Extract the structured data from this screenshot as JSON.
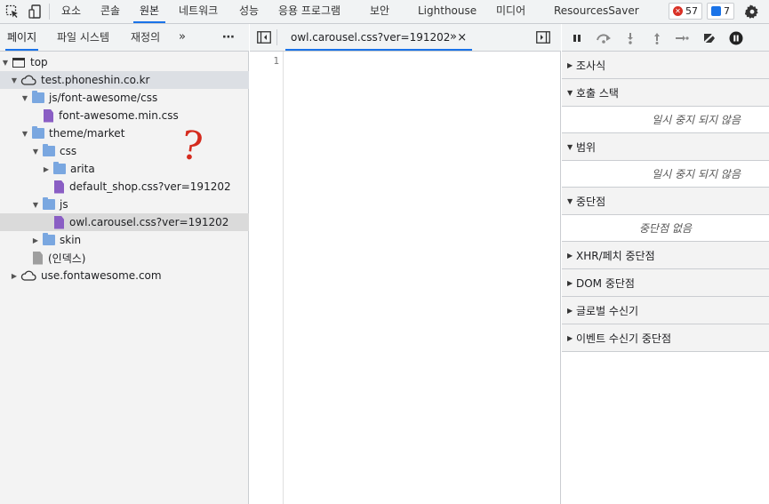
{
  "top_tabs": [
    "요소",
    "콘솔",
    "원본",
    "네트워크",
    "성능",
    "응용 프로그램",
    "보안",
    "Lighthouse",
    "미디어",
    "ResourcesSaver"
  ],
  "badges": {
    "errors": "57",
    "messages": "7"
  },
  "colors": {
    "accent": "#1a73e8",
    "error": "#d93025",
    "info": "#1a73e8",
    "annotation": "#d52b1e"
  },
  "navigator": {
    "tabs": [
      "페이지",
      "파일 시스템",
      "재정의"
    ],
    "more_label": "»",
    "menu_label": "⋯"
  },
  "tree": [
    {
      "label": "top",
      "type": "frame",
      "expanded": true
    },
    {
      "label": "test.phoneshin.co.kr",
      "type": "domain",
      "expanded": true
    },
    {
      "label": "js/font-awesome/css",
      "type": "folder",
      "expanded": true
    },
    {
      "label": "font-awesome.min.css",
      "type": "file"
    },
    {
      "label": "theme/market",
      "type": "folder",
      "expanded": true
    },
    {
      "label": "css",
      "type": "folder",
      "expanded": true
    },
    {
      "label": "arita",
      "type": "folder",
      "expanded": false
    },
    {
      "label": "default_shop.css?ver=191202",
      "type": "file"
    },
    {
      "label": "js",
      "type": "folder",
      "expanded": true
    },
    {
      "label": "owl.carousel.css?ver=191202",
      "type": "file",
      "selected": true
    },
    {
      "label": "skin",
      "type": "folder",
      "expanded": false
    },
    {
      "label": "(인덱스)",
      "type": "document"
    },
    {
      "label": "use.fontawesome.com",
      "type": "domain",
      "expanded": false
    }
  ],
  "annotation": "?",
  "editor": {
    "tab_label": "owl.carousel.css?ver=191202",
    "close_label": "×",
    "more_label": "»",
    "line_number": "1"
  },
  "debugger": {
    "sections": [
      {
        "title": "조사식",
        "expanded": false
      },
      {
        "title": "호출 스택",
        "expanded": true,
        "body": "일시 중지 되지 않음"
      },
      {
        "title": "범위",
        "expanded": true,
        "body": "일시 중지 되지 않음"
      },
      {
        "title": "중단점",
        "expanded": true,
        "body": "중단점 없음"
      },
      {
        "title": "XHR/페치 중단점",
        "expanded": false
      },
      {
        "title": "DOM 중단점",
        "expanded": false
      },
      {
        "title": "글로벌 수신기",
        "expanded": false
      },
      {
        "title": "이벤트 수신기 중단점",
        "expanded": false
      }
    ]
  }
}
